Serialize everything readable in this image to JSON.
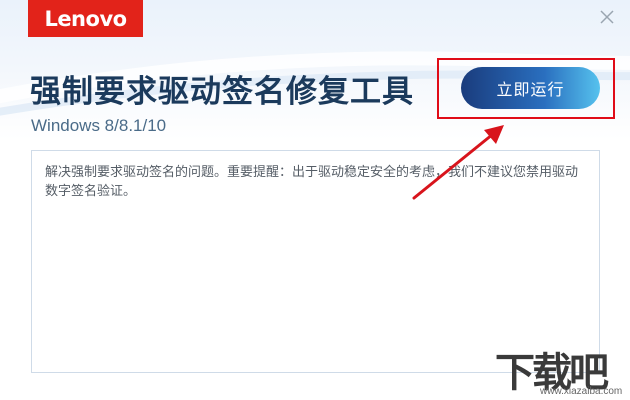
{
  "app": {
    "brand": "Lenovo",
    "title": "强制要求驱动签名修复工具",
    "subtitle": "Windows 8/8.1/10"
  },
  "actions": {
    "run_label": "立即运行"
  },
  "message": {
    "text": "解决强制要求驱动签名的问题。重要提醒：出于驱动稳定安全的考虑，我们不建议您禁用驱动数字签名验证。"
  },
  "watermark": {
    "text": "下载吧",
    "url": "www.xiazaiba.com"
  },
  "colors": {
    "brand_red": "#e2231a",
    "title": "#1b3a5c",
    "button_start": "#1a3c7d",
    "button_end": "#56c2ee",
    "annotation_red": "#e00c18"
  },
  "icons": {
    "close": "close-icon"
  }
}
